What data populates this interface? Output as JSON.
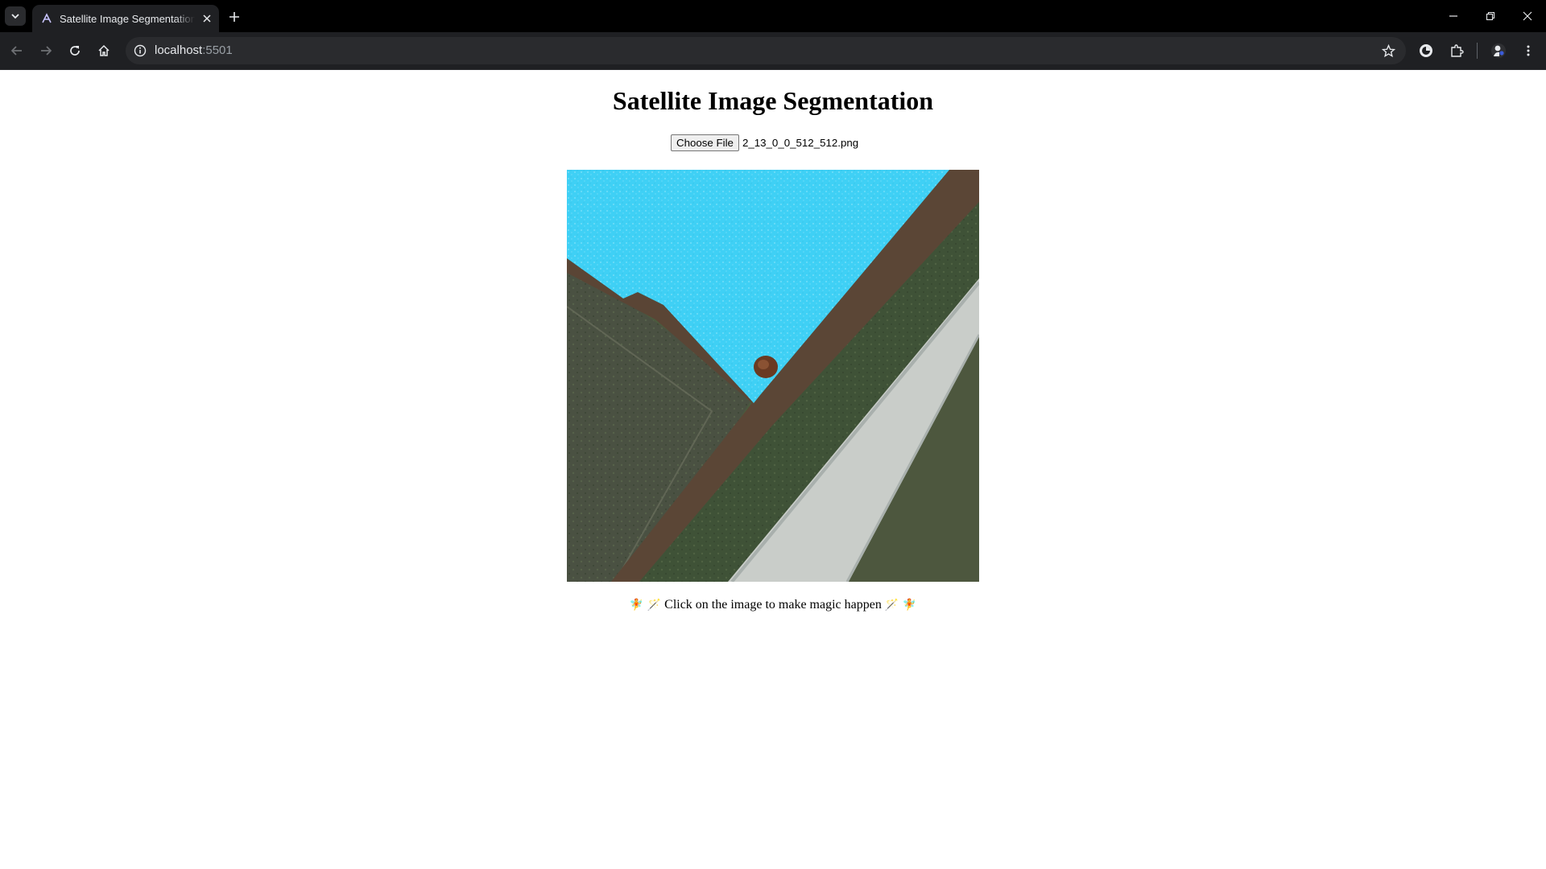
{
  "browser": {
    "tab_title": "Satellite Image Segmentation",
    "url_host": "localhost",
    "url_port": ":5501",
    "icons": [
      "tab-list-icon",
      "favicon-icon",
      "close-icon",
      "plus-icon",
      "minimize-icon",
      "restore-icon",
      "close-window-icon",
      "back-arrow-icon",
      "forward-arrow-icon",
      "reload-icon",
      "home-icon",
      "site-info-icon",
      "bookmark-star-icon",
      "account-icon",
      "extensions-icon",
      "profile-icon",
      "menu-dots-icon"
    ]
  },
  "page": {
    "title": "Satellite Image Segmentation",
    "choose_file_label": "Choose File",
    "file_name": "2_13_0_0_512_512.png",
    "caption_left_emoji": "🧚 🪄",
    "caption_text": "Click on the image to make magic happen",
    "caption_right_emoji": "🪄 🧚",
    "colors": {
      "segmentation_mask": "#3fd0f5",
      "text": "#000000"
    }
  }
}
